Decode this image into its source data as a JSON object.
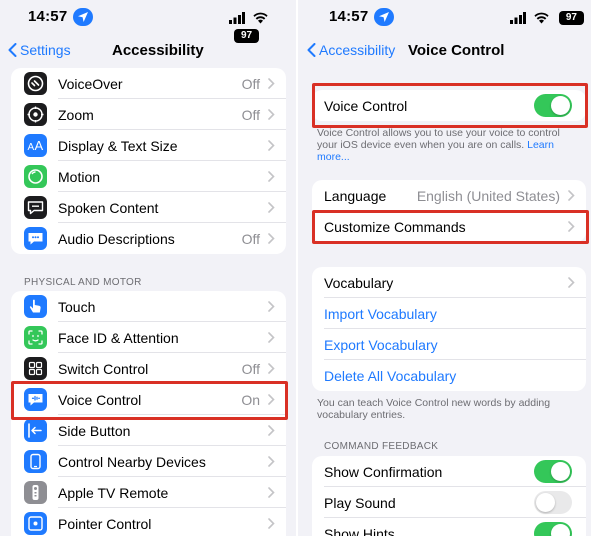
{
  "colors": {
    "accent_blue": "#1f7aff",
    "toggle_green": "#34c759",
    "highlight_red": "#d93025"
  },
  "left": {
    "status": {
      "time": "14:57",
      "battery": "97"
    },
    "nav": {
      "back_label": "Settings",
      "title": "Accessibility"
    },
    "vision_items": [
      {
        "label": "VoiceOver",
        "value": "Off",
        "icon": "voiceover-icon",
        "color": "#1c1c1e"
      },
      {
        "label": "Zoom",
        "value": "Off",
        "icon": "zoom-icon",
        "color": "#1c1c1e"
      },
      {
        "label": "Display & Text Size",
        "value": "",
        "icon": "text-size-icon",
        "color": "#1f7aff"
      },
      {
        "label": "Motion",
        "value": "",
        "icon": "motion-icon",
        "color": "#34c759"
      },
      {
        "label": "Spoken Content",
        "value": "",
        "icon": "speech-bubble-icon",
        "color": "#1c1c1e"
      },
      {
        "label": "Audio Descriptions",
        "value": "Off",
        "icon": "audio-descriptions-icon",
        "color": "#1f7aff"
      }
    ],
    "section_header": "PHYSICAL AND MOTOR",
    "motor_items": [
      {
        "label": "Touch",
        "value": "",
        "icon": "hand-icon",
        "color": "#1f7aff"
      },
      {
        "label": "Face ID & Attention",
        "value": "",
        "icon": "face-id-icon",
        "color": "#34c759"
      },
      {
        "label": "Switch Control",
        "value": "Off",
        "icon": "switch-grid-icon",
        "color": "#1c1c1e"
      },
      {
        "label": "Voice Control",
        "value": "On",
        "icon": "voice-control-icon",
        "color": "#1f7aff"
      },
      {
        "label": "Side Button",
        "value": "",
        "icon": "side-button-icon",
        "color": "#1f7aff"
      },
      {
        "label": "Control Nearby Devices",
        "value": "",
        "icon": "nearby-devices-icon",
        "color": "#1f7aff"
      },
      {
        "label": "Apple TV Remote",
        "value": "",
        "icon": "remote-icon",
        "color": "#8e8e93"
      },
      {
        "label": "Pointer Control",
        "value": "",
        "icon": "pointer-icon",
        "color": "#1f7aff"
      }
    ]
  },
  "right": {
    "status": {
      "time": "14:57",
      "battery": "97"
    },
    "nav": {
      "back_label": "Accessibility",
      "title": "Voice Control"
    },
    "voice_control": {
      "label": "Voice Control",
      "enabled": true
    },
    "voice_control_footer": "Voice Control allows you to use your voice to control your iOS device even when you are on calls.",
    "voice_control_footer_link": "Learn more...",
    "language": {
      "label": "Language",
      "value": "English (United States)"
    },
    "customize_commands": {
      "label": "Customize Commands"
    },
    "vocabulary": {
      "title": "Vocabulary",
      "import_label": "Import Vocabulary",
      "export_label": "Export Vocabulary",
      "delete_label": "Delete All Vocabulary"
    },
    "vocabulary_footer": "You can teach Voice Control new words by adding vocabulary entries.",
    "feedback_header": "COMMAND FEEDBACK",
    "feedback": [
      {
        "label": "Show Confirmation",
        "enabled": true
      },
      {
        "label": "Play Sound",
        "enabled": false
      },
      {
        "label": "Show Hints",
        "enabled": true
      }
    ]
  }
}
